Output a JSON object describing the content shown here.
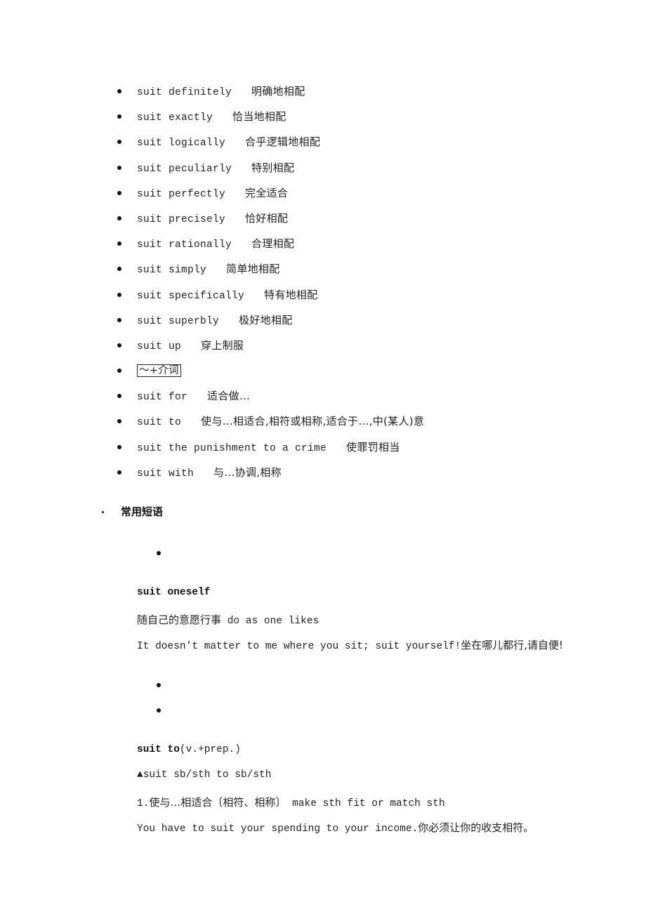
{
  "collocations": [
    {
      "en": "suit definitely",
      "zh": "明确地相配"
    },
    {
      "en": "suit exactly",
      "zh": "恰当地相配"
    },
    {
      "en": "suit logically",
      "zh": "合乎逻辑地相配"
    },
    {
      "en": "suit peculiarly",
      "zh": "特别相配"
    },
    {
      "en": "suit perfectly",
      "zh": "完全适合"
    },
    {
      "en": "suit precisely",
      "zh": "恰好相配"
    },
    {
      "en": "suit rationally",
      "zh": "合理相配"
    },
    {
      "en": "suit simply",
      "zh": "简单地相配"
    },
    {
      "en": "suit specifically",
      "zh": "特有地相配"
    },
    {
      "en": "suit superbly",
      "zh": "极好地相配"
    },
    {
      "en": "suit up",
      "zh": "穿上制服"
    },
    {
      "boxed": "～+介词"
    },
    {
      "en": "suit for",
      "zh": "适合做…"
    },
    {
      "en": "suit to",
      "zh": "使与…相适合,相符或相称,适合于…,中(某人)意"
    },
    {
      "en": "suit the punishment to a crime",
      "zh": "使罪罚相当"
    },
    {
      "en": "suit with",
      "zh": "与…协调,相称"
    }
  ],
  "common_phrases": {
    "heading": "常用短语",
    "phrase1": {
      "title": "suit oneself",
      "definition_zh": "随自己的意愿行事",
      "definition_en": "do as one likes",
      "example_en": "It doesn't matter to me where you sit; suit yourself!",
      "example_zh": "坐在哪儿都行,请自便!"
    },
    "phrase2": {
      "title": "suit to",
      "pos": "(v.+prep.)",
      "pattern": "▲suit sb/sth to sb/sth",
      "sense_number": "1.",
      "sense_zh": "使与…相适合〔相符、相称〕",
      "sense_en": "make sth fit or match sth",
      "example_en": "You have to suit your spending to your income.",
      "example_zh": "你必须让你的收支相符。"
    }
  }
}
